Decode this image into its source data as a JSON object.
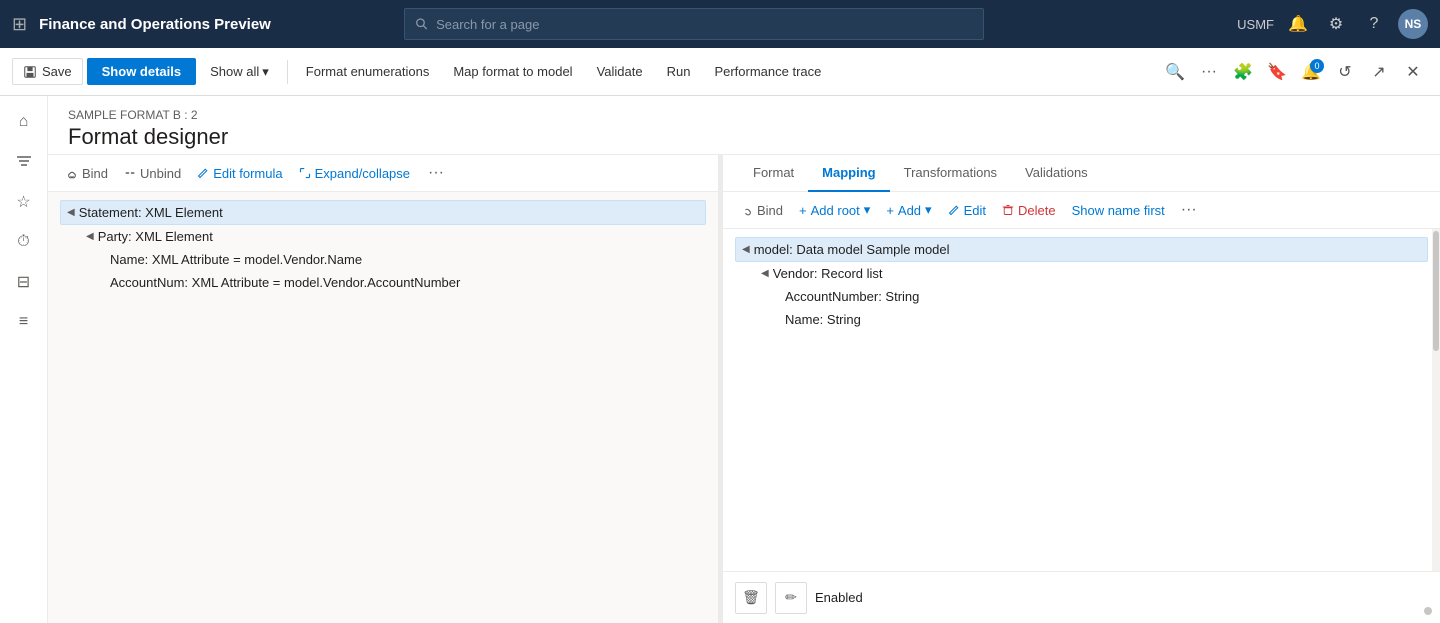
{
  "topNav": {
    "appIcon": "⊞",
    "title": "Finance and Operations Preview",
    "searchPlaceholder": "Search for a page",
    "orgLabel": "USMF",
    "avatarLabel": "NS"
  },
  "toolbar": {
    "saveLabel": "Save",
    "showDetailsLabel": "Show details",
    "showAllLabel": "Show all",
    "formatEnumerationsLabel": "Format enumerations",
    "mapFormatLabel": "Map format to model",
    "validateLabel": "Validate",
    "runLabel": "Run",
    "performanceTraceLabel": "Performance trace",
    "badgeCount": "0"
  },
  "sidebar": {
    "icons": [
      "⊞",
      "☆",
      "⏱",
      "⊟",
      "≡"
    ]
  },
  "pageHeader": {
    "breadcrumb": "SAMPLE FORMAT B : 2",
    "title": "Format designer"
  },
  "leftPane": {
    "toolbar": {
      "bindLabel": "Bind",
      "unbindLabel": "Unbind",
      "editFormulaLabel": "Edit formula",
      "expandCollapseLabel": "Expand/collapse"
    },
    "treeItems": [
      {
        "id": "statement",
        "label": "Statement: XML Element",
        "indent": 0,
        "toggle": "◀",
        "selected": true
      },
      {
        "id": "party",
        "label": "Party: XML Element",
        "indent": 1,
        "toggle": "◀",
        "selected": false
      },
      {
        "id": "name",
        "label": "Name: XML Attribute = model.Vendor.Name",
        "indent": 2,
        "toggle": "",
        "selected": false
      },
      {
        "id": "accountnum",
        "label": "AccountNum: XML Attribute = model.Vendor.AccountNumber",
        "indent": 2,
        "toggle": "",
        "selected": false
      }
    ]
  },
  "rightPane": {
    "tabs": [
      {
        "id": "format",
        "label": "Format",
        "active": false
      },
      {
        "id": "mapping",
        "label": "Mapping",
        "active": true
      },
      {
        "id": "transformations",
        "label": "Transformations",
        "active": false
      },
      {
        "id": "validations",
        "label": "Validations",
        "active": false
      }
    ],
    "toolbar": {
      "bindLabel": "Bind",
      "addRootLabel": "Add root",
      "addLabel": "Add",
      "editLabel": "Edit",
      "deleteLabel": "Delete",
      "showNameFirstLabel": "Show name first"
    },
    "treeItems": [
      {
        "id": "model",
        "label": "model: Data model Sample model",
        "indent": 0,
        "toggle": "◀",
        "selected": true
      },
      {
        "id": "vendor",
        "label": "Vendor: Record list",
        "indent": 1,
        "toggle": "◀",
        "selected": false
      },
      {
        "id": "accountnumber",
        "label": "AccountNumber: String",
        "indent": 2,
        "toggle": "",
        "selected": false
      },
      {
        "id": "namestr",
        "label": "Name: String",
        "indent": 2,
        "toggle": "",
        "selected": false
      }
    ],
    "bottomPanel": {
      "enabledLabel": "Enabled",
      "deleteIcon": "🗑",
      "editIcon": "✏"
    }
  }
}
